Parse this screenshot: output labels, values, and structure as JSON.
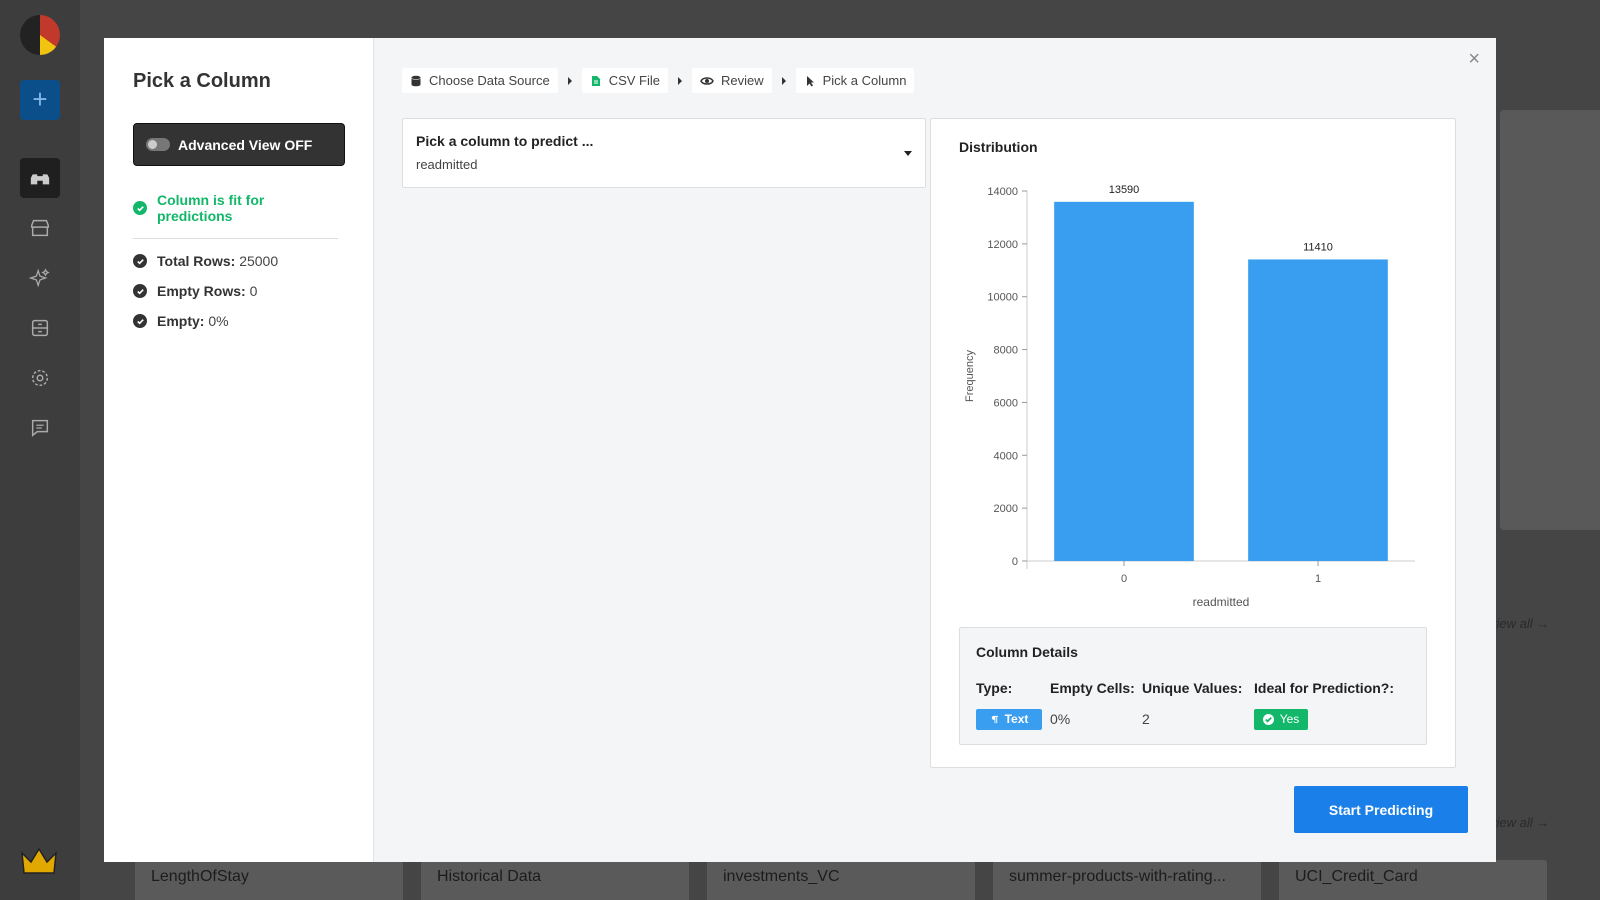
{
  "background": {
    "bottom_cards": [
      "LengthOfStay",
      "Historical Data",
      "investments_VC",
      "summer-products-with-rating...",
      "UCI_Credit_Card"
    ],
    "view_all": "view all →"
  },
  "modal": {
    "title": "Pick a Column",
    "advanced_view_label": "Advanced View OFF",
    "fit_message": "Column is fit for predictions",
    "stats": [
      {
        "label": "Total Rows:",
        "value": "25000"
      },
      {
        "label": "Empty Rows:",
        "value": "0"
      },
      {
        "label": "Empty:",
        "value": "0%"
      }
    ],
    "close_label": "×",
    "breadcrumb": [
      "Choose Data Source",
      "CSV File",
      "Review",
      "Pick a Column"
    ],
    "picker": {
      "label": "Pick a column to predict ...",
      "value": "readmitted"
    },
    "distribution_title": "Distribution",
    "column_details": {
      "title": "Column Details",
      "type_label": "Type:",
      "type_value": "Text",
      "empty_label": "Empty Cells:",
      "empty_value": "0%",
      "unique_label": "Unique Values:",
      "unique_value": "2",
      "ideal_label": "Ideal for Prediction?:",
      "ideal_value": "Yes"
    },
    "start_button": "Start Predicting"
  },
  "colors": {
    "accent": "#1a7fe8",
    "bar": "#3a9ef0",
    "success": "#12b76a"
  },
  "chart_data": {
    "type": "bar",
    "categories": [
      "0",
      "1"
    ],
    "values": [
      13590,
      11410
    ],
    "title": "",
    "xlabel": "readmitted",
    "ylabel": "Frequency",
    "ylim": [
      0,
      14000
    ],
    "yticks": [
      0,
      2000,
      4000,
      6000,
      8000,
      10000,
      12000,
      14000
    ],
    "data_labels": [
      "13590",
      "11410"
    ]
  }
}
